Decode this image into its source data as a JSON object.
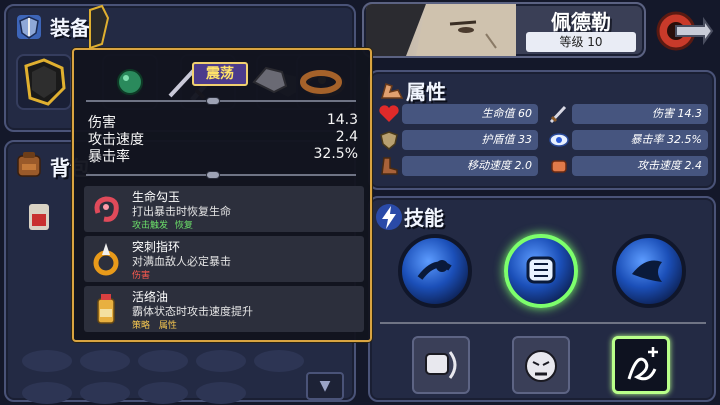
{
  "equipment": {
    "title": "装备"
  },
  "bag": {
    "title": "背包"
  },
  "character": {
    "name": "佩德勒",
    "level": "等级 10"
  },
  "attributes": {
    "title": "属性",
    "items": [
      {
        "label": "生命值 60"
      },
      {
        "label": "伤害 14.3"
      },
      {
        "label": "护盾值 33"
      },
      {
        "label": "暴击率 32.5%"
      },
      {
        "label": "移动速度 2.0"
      },
      {
        "label": "攻击速度 2.4"
      }
    ]
  },
  "skills": {
    "title": "技能"
  },
  "tooltip": {
    "tag": "震荡",
    "stats": [
      {
        "label": "伤害",
        "value": "14.3"
      },
      {
        "label": "攻击速度",
        "value": "2.4"
      },
      {
        "label": "暴击率",
        "value": "32.5%"
      }
    ],
    "effects": [
      {
        "name": "生命勾玉",
        "desc": "打出暴击时恢复生命",
        "tag1": "攻击触发",
        "tag2": "恢复"
      },
      {
        "name": "突刺指环",
        "desc": "对满血敌人必定暴击",
        "tag1": "伤害",
        "tag2": ""
      },
      {
        "name": "活络油",
        "desc": "霸体状态时攻击速度提升",
        "tag1": "策略",
        "tag2": "属性"
      }
    ]
  },
  "icons": {
    "equipment": "shield-sword-icon",
    "bag": "backpack-icon",
    "attributes": "muscle-icon",
    "skills": "lightning-icon",
    "back": "back-arrow-icon",
    "scroll": "chevron-down-icon"
  },
  "colors": {
    "gold_border": "#d9a441",
    "panel": "#232a44",
    "attr_bar": "#46557f",
    "selected_glow": "#7dff6c"
  }
}
